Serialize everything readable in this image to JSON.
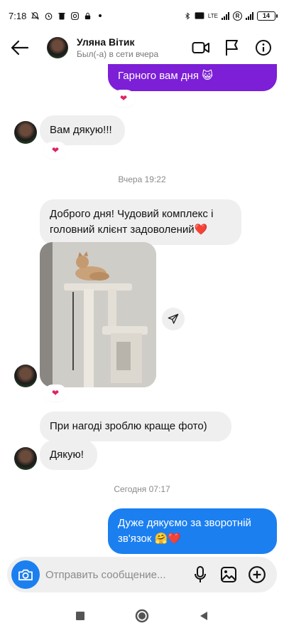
{
  "status_bar": {
    "time": "7:18",
    "battery": "14",
    "network": "LTE",
    "roaming": "R"
  },
  "header": {
    "name": "Уляна Вітик",
    "status": "Был(-а) в сети вчера"
  },
  "messages": {
    "top_out": "Гарного вам дня 😺",
    "msg1": "Вам дякую!!!",
    "ts1": "Вчера 19:22",
    "msg2": "Доброго дня! Чудовий комплекс і головний клієнт задоволений❤️",
    "msg3": "При нагоді зроблю краще фото)",
    "msg4": "Дякую!",
    "ts2": "Сегодня 07:17",
    "msg5": "Дуже дякуємо за зворотній зв'язок 🤗❤️"
  },
  "reactions": {
    "heart": "❤"
  },
  "composer": {
    "placeholder": "Отправить сообщение..."
  },
  "colors": {
    "outgoing_purple": "#7c1fd6",
    "outgoing_blue": "#1b7ff0",
    "incoming_gray": "#efefef",
    "heart_red": "#e0245e"
  }
}
